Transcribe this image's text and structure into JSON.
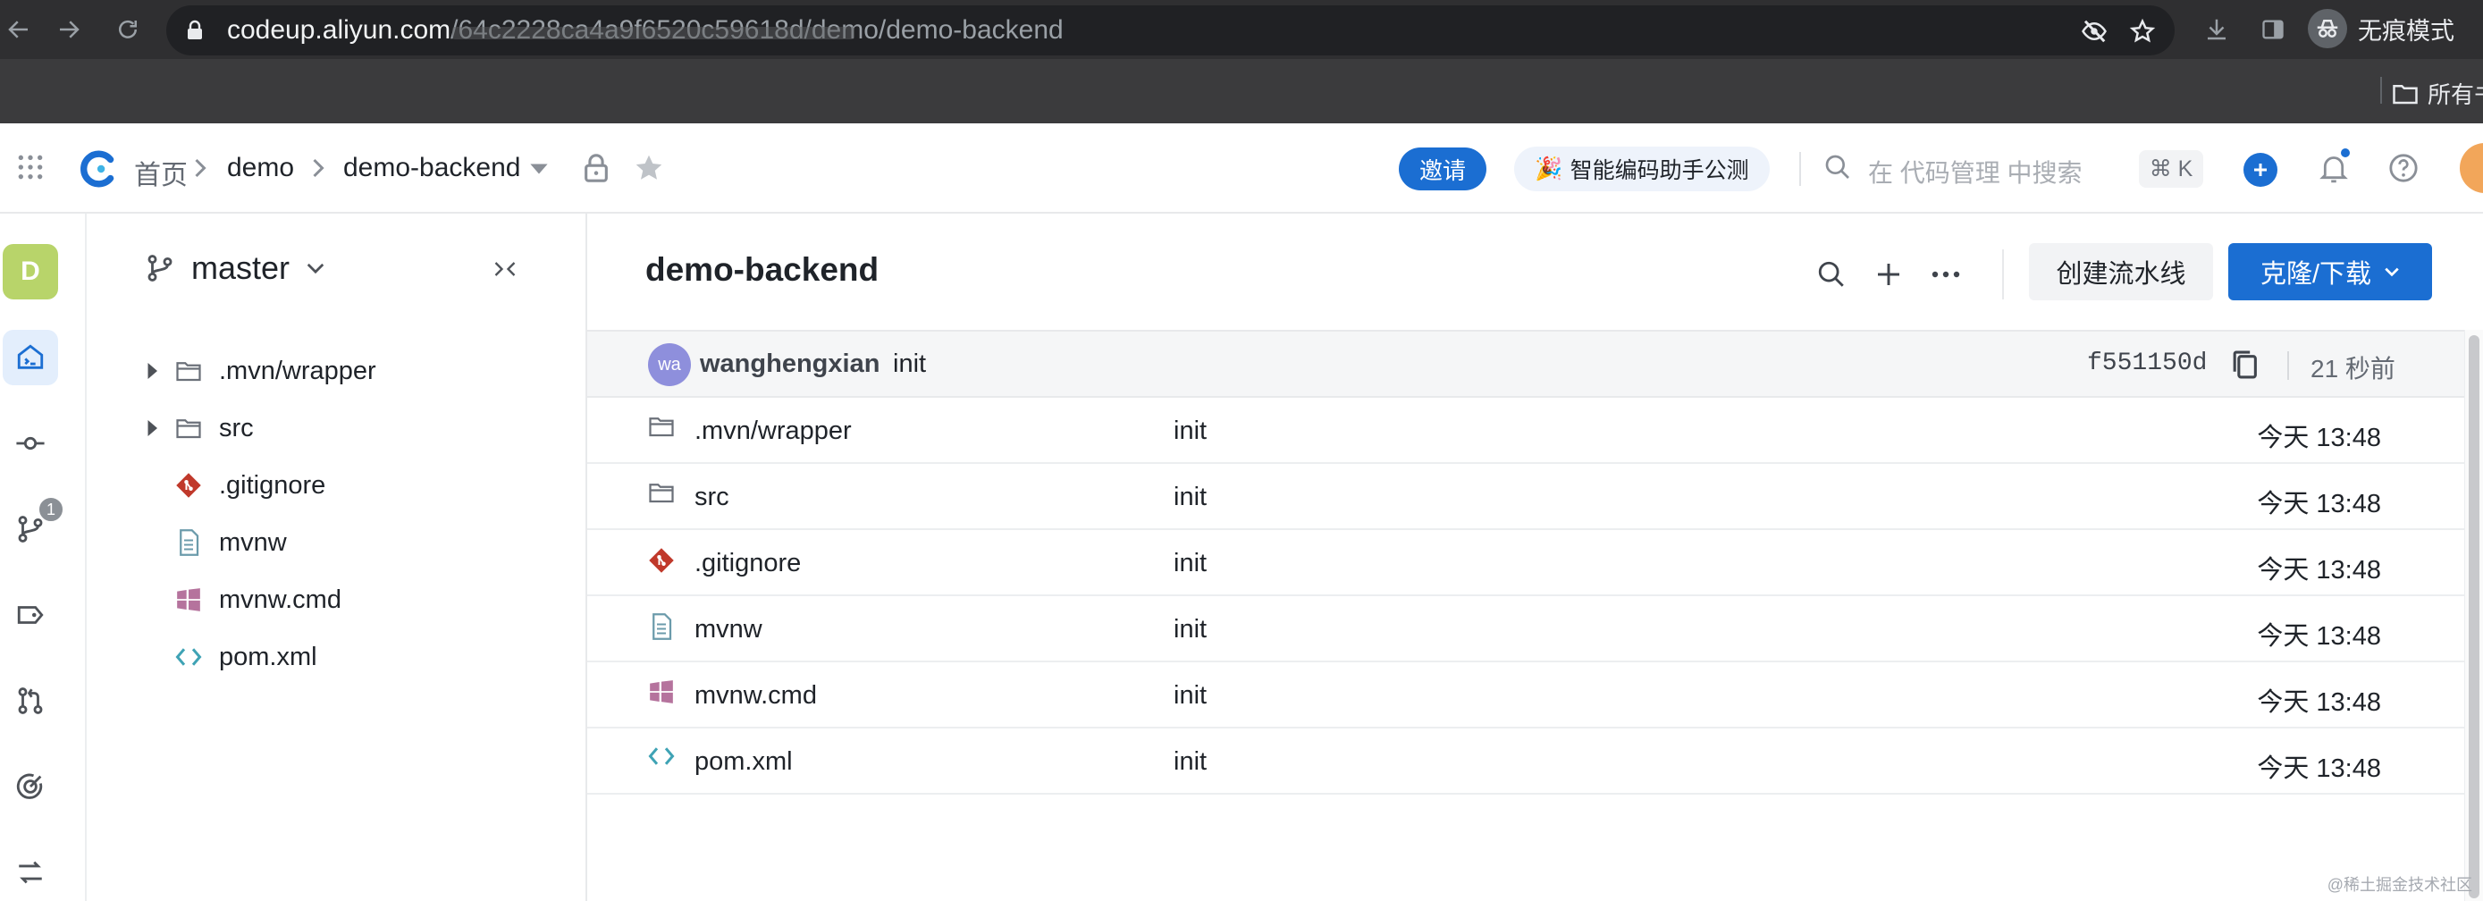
{
  "browser": {
    "url_domain": "codeup.aliyun.com",
    "url_path": "/64c2228ca4a9f6520c59618d/demo/demo-backend",
    "incognito_label": "无痕模式",
    "bookmark_folder": "所有书签"
  },
  "header": {
    "home": "首页",
    "group": "demo",
    "repo": "demo-backend",
    "invite": "邀请",
    "ai_promo": "智能编码助手公测",
    "ai_emoji": "🎉",
    "search_placeholder": "在 代码管理 中搜索",
    "shortcut": "⌘ K"
  },
  "rail": {
    "workspace_initial": "D",
    "branches_badge": "1"
  },
  "tree": {
    "branch": "master",
    "items": [
      {
        "name": ".mvn/wrapper",
        "type": "folder",
        "icon": "folder-icon"
      },
      {
        "name": "src",
        "type": "folder",
        "icon": "folder-icon"
      },
      {
        "name": ".gitignore",
        "type": "git",
        "icon": "git-icon"
      },
      {
        "name": "mvnw",
        "type": "file",
        "icon": "file-icon"
      },
      {
        "name": "mvnw.cmd",
        "type": "windows",
        "icon": "windows-icon"
      },
      {
        "name": "pom.xml",
        "type": "code",
        "icon": "code-icon"
      }
    ]
  },
  "main": {
    "title": "demo-backend",
    "pipeline_button": "创建流水线",
    "clone_button": "克隆/下载",
    "latest_commit": {
      "avatar": "wa",
      "author": "wanghengxian",
      "message": "init",
      "sha": "f551150d",
      "time": "21 秒前"
    },
    "files": [
      {
        "name": ".mvn/wrapper",
        "type": "folder",
        "message": "init",
        "time": "今天 13:48"
      },
      {
        "name": "src",
        "type": "folder",
        "message": "init",
        "time": "今天 13:48"
      },
      {
        "name": ".gitignore",
        "type": "git",
        "message": "init",
        "time": "今天 13:48"
      },
      {
        "name": "mvnw",
        "type": "file",
        "message": "init",
        "time": "今天 13:48"
      },
      {
        "name": "mvnw.cmd",
        "type": "windows",
        "message": "init",
        "time": "今天 13:48"
      },
      {
        "name": "pom.xml",
        "type": "code",
        "message": "init",
        "time": "今天 13:48"
      }
    ]
  },
  "watermark": "@稀土掘金技术社区",
  "colors": {
    "accent": "#1b6ed2",
    "git": "#c0392b",
    "windows": "#b5739d",
    "code": "#3fa3b5"
  }
}
